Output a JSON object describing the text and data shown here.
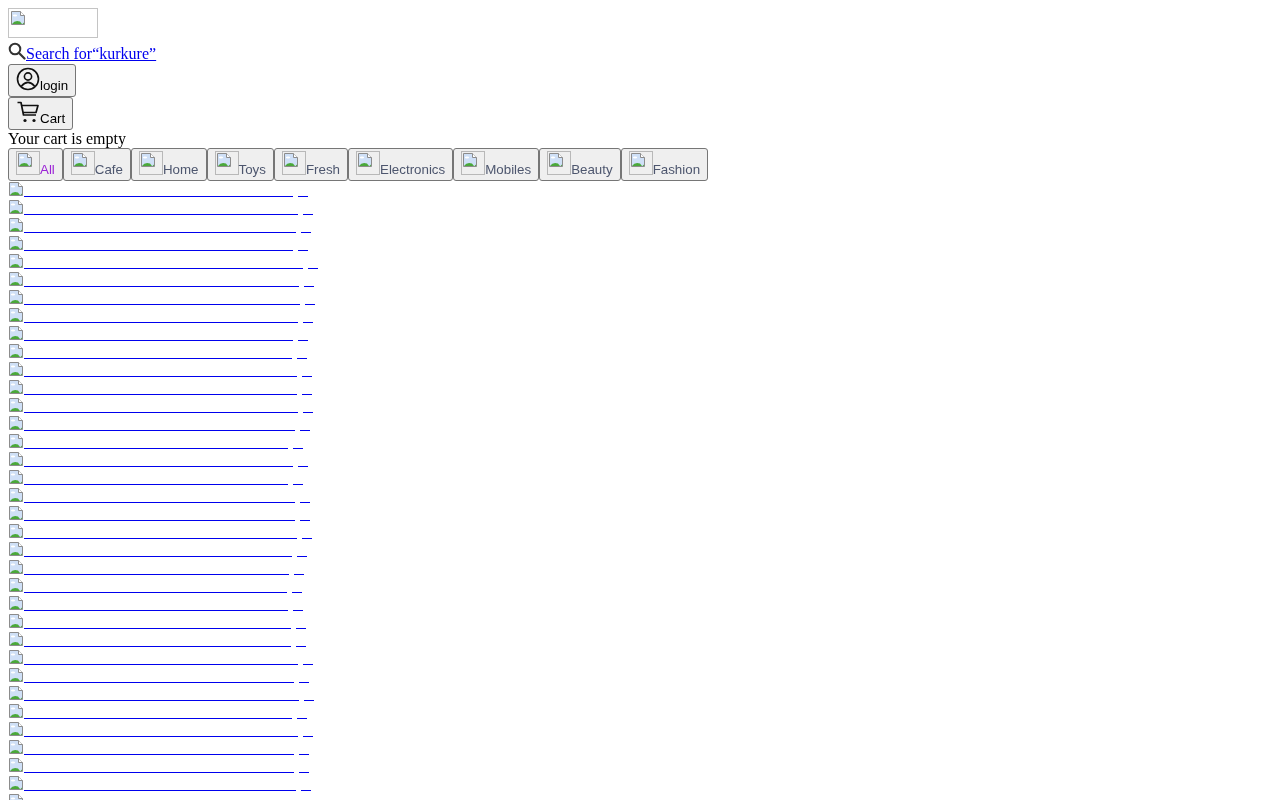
{
  "header": {
    "search_link": "Search for“kurkure”",
    "login_button": "login",
    "cart_button": "Cart",
    "cart_status": "Your cart is empty"
  },
  "categories": [
    {
      "label": "All",
      "selected": true
    },
    {
      "label": "Cafe",
      "selected": false
    },
    {
      "label": "Home",
      "selected": false
    },
    {
      "label": "Toys",
      "selected": false
    },
    {
      "label": "Fresh",
      "selected": false
    },
    {
      "label": "Electronics",
      "selected": false
    },
    {
      "label": "Mobiles",
      "selected": false
    },
    {
      "label": "Beauty",
      "selected": false
    },
    {
      "label": "Fashion",
      "selected": false
    }
  ],
  "product_links": [
    {
      "kind": "broken-image"
    },
    {
      "kind": "broken-image"
    },
    {
      "kind": "broken-image"
    },
    {
      "kind": "broken-image"
    },
    {
      "kind": "broken-image"
    },
    {
      "kind": "broken-image"
    },
    {
      "kind": "broken-image"
    },
    {
      "kind": "broken-image"
    },
    {
      "kind": "broken-image"
    },
    {
      "kind": "broken-image"
    },
    {
      "kind": "broken-image"
    },
    {
      "kind": "broken-image"
    },
    {
      "kind": "broken-image"
    },
    {
      "kind": "broken-image"
    },
    {
      "kind": "broken-image"
    },
    {
      "kind": "broken-image"
    },
    {
      "kind": "broken-image"
    },
    {
      "kind": "broken-image"
    },
    {
      "kind": "broken-image"
    },
    {
      "kind": "broken-image"
    },
    {
      "kind": "broken-image"
    },
    {
      "kind": "broken-image"
    },
    {
      "kind": "broken-image"
    },
    {
      "kind": "broken-image"
    },
    {
      "kind": "broken-image"
    },
    {
      "kind": "broken-image"
    },
    {
      "kind": "broken-image"
    },
    {
      "kind": "broken-image"
    },
    {
      "kind": "broken-image"
    },
    {
      "kind": "broken-image"
    },
    {
      "kind": "broken-image"
    },
    {
      "kind": "broken-image"
    },
    {
      "kind": "broken-image"
    },
    {
      "kind": "broken-image"
    },
    {
      "kind": "broken-image"
    }
  ]
}
